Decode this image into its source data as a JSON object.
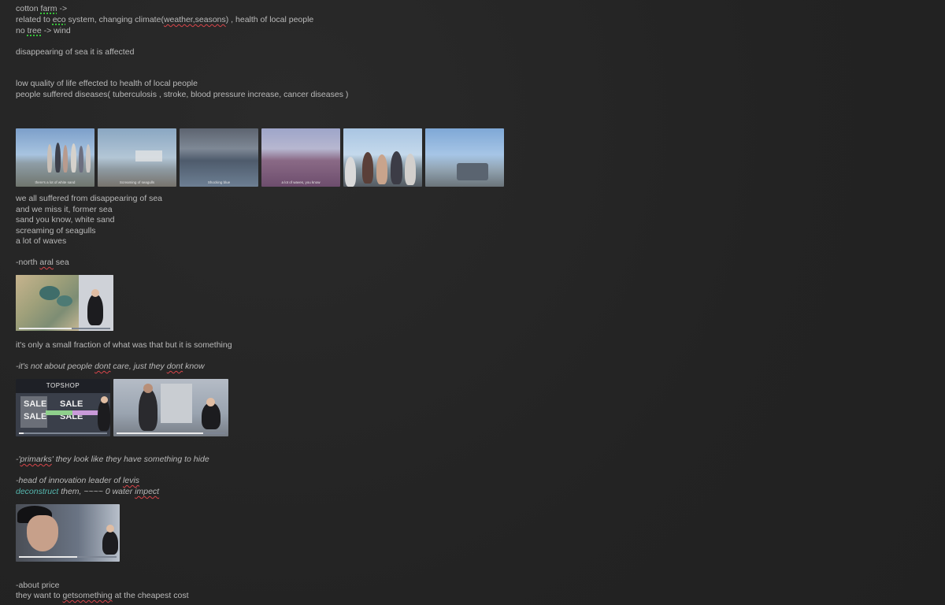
{
  "notes": {
    "l1": {
      "a": "cotton ",
      "b": "farm",
      "c": " ->"
    },
    "l2": {
      "a": "related to ",
      "b": "eco",
      "c": " system, changing climate(",
      "d": "weather,seasons",
      "e": ") , health of local people"
    },
    "l3": {
      "a": "no ",
      "b": "tree",
      "c": " -> wind"
    },
    "l4": "disappearing of sea it is affected",
    "l5": "low quality of life effected to health of local people",
    "l6": "people suffered diseases( tuberculosis , stroke, blood pressure increase, cancer diseases )",
    "l7": "we all suffered from disappearing of sea",
    "l8": "and we miss it, former sea",
    "l9": "sand you know, white sand",
    "l10": "screaming of seagulls",
    "l11": "a lot of waves",
    "l12": {
      "a": "-north ",
      "b": "aral",
      "c": " sea"
    },
    "l13": "it's only a small fraction of what was that but it is something",
    "l14": {
      "a": "-it's not about people ",
      "b": "dont",
      "c": " care, just they ",
      "d": "dont",
      "e": " know"
    },
    "l15": {
      "a": "-'",
      "b": "primarks",
      "c": "'  they look like they have something to hide"
    },
    "l16": {
      "a": "-head of innovation leader of ",
      "b": "levis"
    },
    "l17": {
      "a": "deconstruct",
      "b": " them, ~~~~ 0 water ",
      "c": "impect"
    },
    "l18": "-about price",
    "l19": {
      "a": "they want to ",
      "b": "getsomething",
      "c": " at the cheapest cost"
    }
  },
  "captions": {
    "c1": "there's a lot of white sand",
    "c2": "Screaming of seagulls",
    "c3": "Shocking blue",
    "c4": "a lot of waves, you know",
    "c5": "",
    "c6": ""
  },
  "video_text": {
    "topshop": "TOPSHOP",
    "sale": "SALE"
  },
  "colors": {
    "background": "#252525",
    "text": "#b9b9b9",
    "accent_teal": "#56b8b0",
    "spell_red": "#d8454a",
    "spell_green": "#37c23a"
  }
}
